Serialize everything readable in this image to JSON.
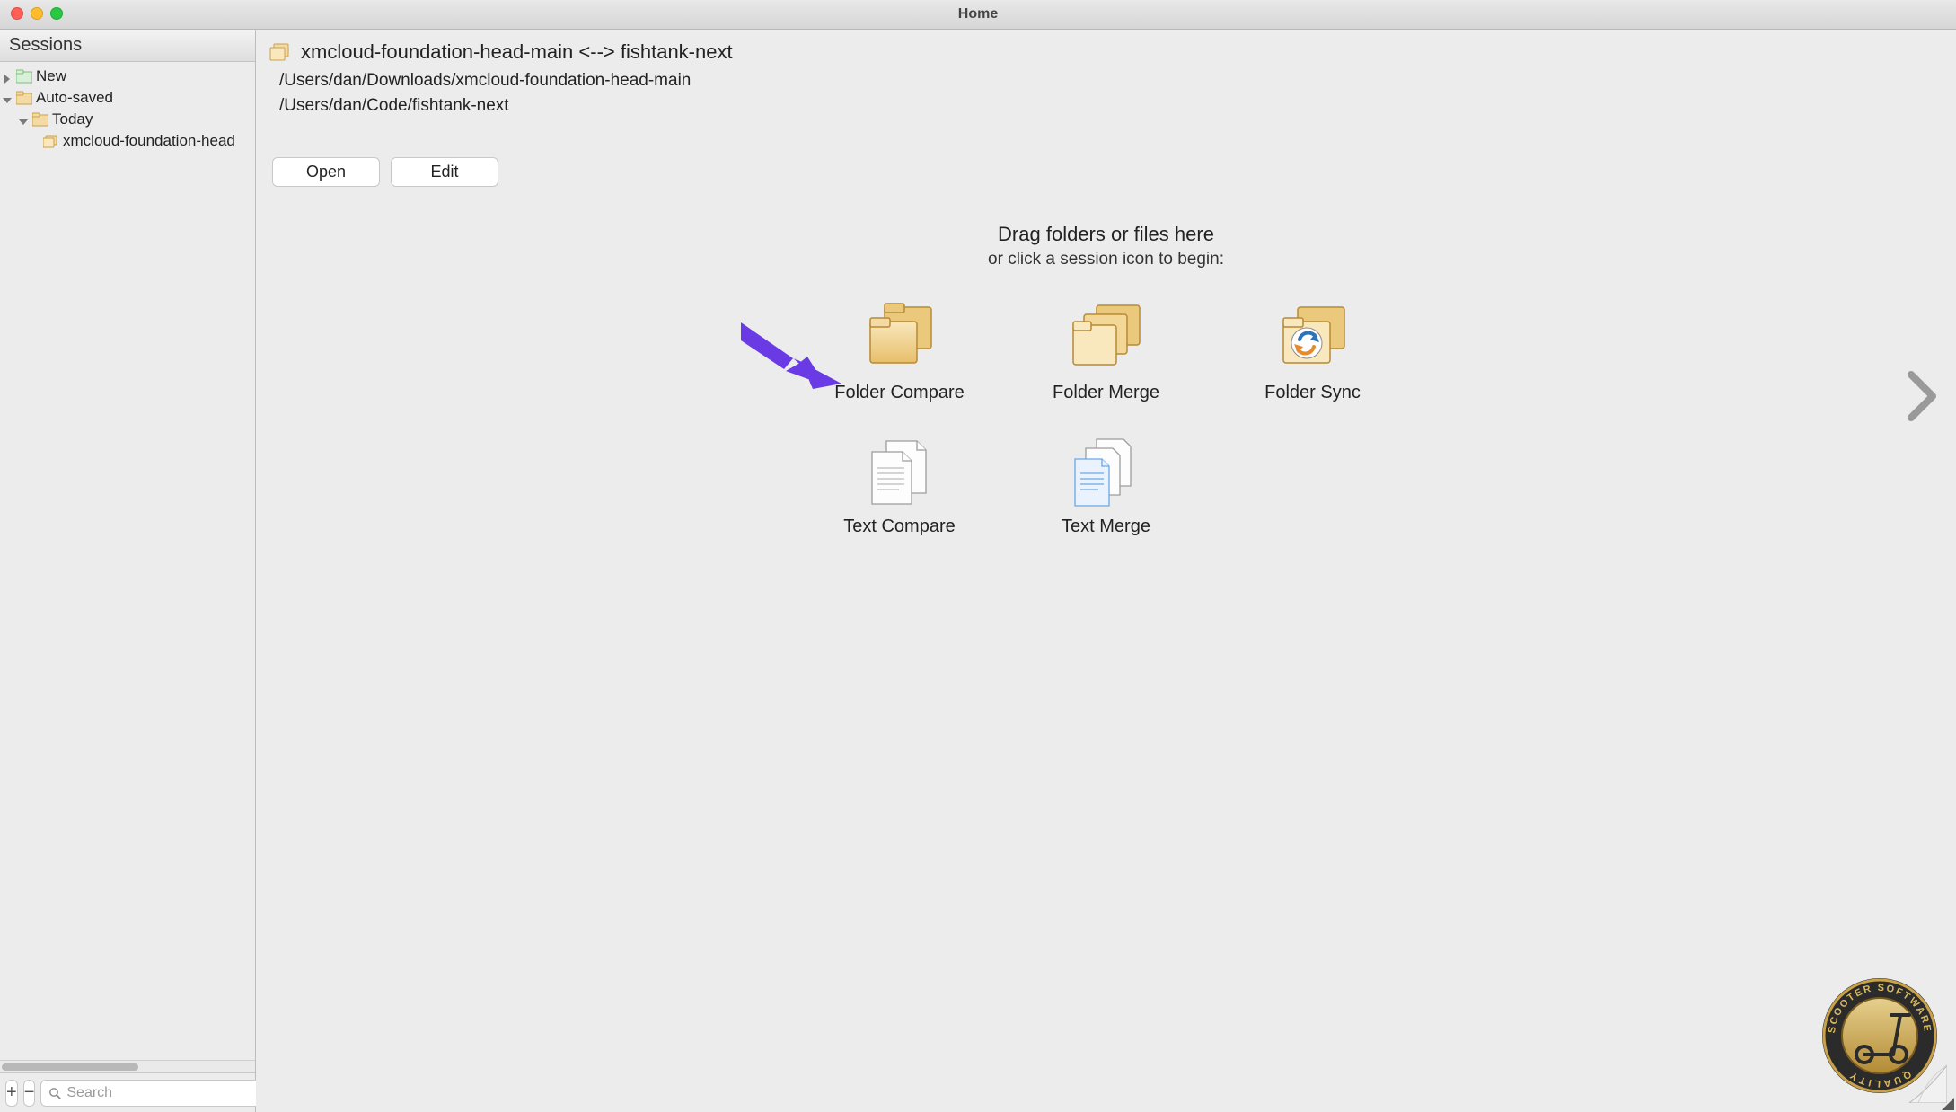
{
  "window": {
    "title": "Home"
  },
  "sidebar": {
    "header": "Sessions",
    "tree": {
      "new": "New",
      "auto_saved": "Auto-saved",
      "today": "Today",
      "item0": "xmcloud-foundation-head"
    },
    "bottom": {
      "add": "+",
      "remove": "−",
      "search_placeholder": "Search"
    }
  },
  "main": {
    "session_title": "xmcloud-foundation-head-main <--> fishtank-next",
    "path_left": "/Users/dan/Downloads/xmcloud-foundation-head-main",
    "path_right": "/Users/dan/Code/fishtank-next",
    "buttons": {
      "open": "Open",
      "edit": "Edit"
    },
    "drop": {
      "heading": "Drag folders or files here",
      "sub": "or click a session icon to begin:"
    },
    "types": {
      "folder_compare": "Folder Compare",
      "folder_merge": "Folder Merge",
      "folder_sync": "Folder Sync",
      "text_compare": "Text Compare",
      "text_merge": "Text Merge"
    },
    "seal_text": {
      "top": "SCOOTER SOFTWARE",
      "bottom": "QUALITY"
    }
  },
  "colors": {
    "folder_light": "#f4dba5",
    "folder_dark": "#d9a93f",
    "accent_arrow": "#6a3be4",
    "sync_blue": "#2e72b8",
    "sync_orange": "#e58a2e",
    "seal_gold": "#c9a24a",
    "seal_ring": "#2b2b2b"
  }
}
